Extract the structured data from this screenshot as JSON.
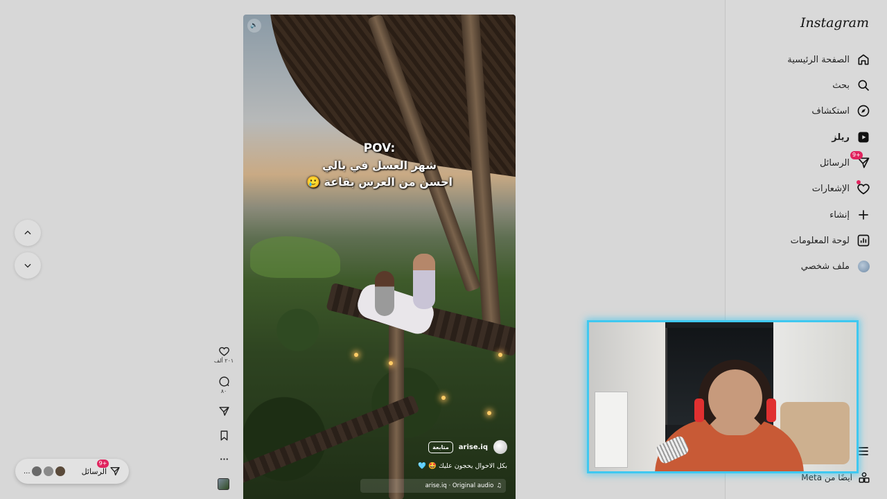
{
  "sidebar": {
    "logo": "Instagram",
    "items": [
      {
        "label": "الصفحة الرئيسية",
        "icon": "home-icon"
      },
      {
        "label": "بحث",
        "icon": "search-icon"
      },
      {
        "label": "استكشاف",
        "icon": "compass-icon"
      },
      {
        "label": "ريلز",
        "icon": "reels-icon",
        "active": true
      },
      {
        "label": "الرسائل",
        "icon": "messages-icon",
        "badge": "9+"
      },
      {
        "label": "الإشعارات",
        "icon": "heart-icon"
      },
      {
        "label": "إنشاء",
        "icon": "plus-icon"
      },
      {
        "label": "لوحة المعلومات",
        "icon": "dashboard-icon"
      },
      {
        "label": "ملف شخصي",
        "icon": "profile-avatar"
      }
    ],
    "also_from_meta": "أيضًا من Meta"
  },
  "reel": {
    "overlay": {
      "pov": "POV:",
      "line2": "شهر العسل في بالي",
      "line3": "احسن من العرس بقاعة 🥲"
    },
    "creator": {
      "username": "arise.iq",
      "follow_label": "متابعة"
    },
    "caption": "بكل الاحوال يحجون عليك 🤩 🩵",
    "audio": "arise.iq · Original audio"
  },
  "actions": {
    "likes": "٢٠١ ألف",
    "comments": "٨٠"
  },
  "messages_pill": {
    "label": "الرسائل",
    "badge": "9+",
    "more": "..."
  },
  "colors": {
    "accent_badge": "#e0245e",
    "webcam_border": "#3fc8f0",
    "background": "#d7d7d7"
  }
}
